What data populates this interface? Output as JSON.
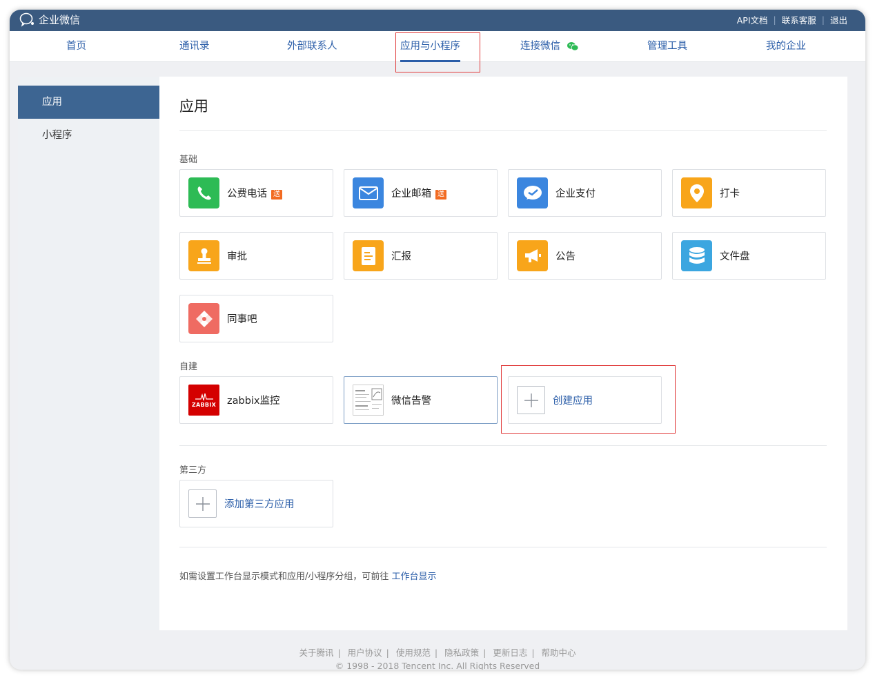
{
  "app": {
    "logo_text": "企业微信"
  },
  "top_links": [
    "API文档",
    "联系客服",
    "退出"
  ],
  "nav": {
    "tabs": [
      "首页",
      "通讯录",
      "外部联系人",
      "应用与小程序",
      "连接微信",
      "管理工具",
      "我的企业"
    ],
    "active_index": 3
  },
  "sidebar": {
    "items": [
      "应用",
      "小程序"
    ],
    "active_index": 0
  },
  "page_title": "应用",
  "sections": {
    "basic": "基础",
    "custom": "自建",
    "third_party": "第三方"
  },
  "basic_apps": [
    {
      "label": "公费电话",
      "badge": "送",
      "icon": "phone-icon",
      "color": "#2dbb55"
    },
    {
      "label": "企业邮箱",
      "badge": "送",
      "icon": "mail-icon",
      "color": "#3b86df"
    },
    {
      "label": "企业支付",
      "icon": "pay-icon",
      "color": "#3b86df"
    },
    {
      "label": "打卡",
      "icon": "location-pin-icon",
      "color": "#f8a51a"
    },
    {
      "label": "审批",
      "icon": "stamp-icon",
      "color": "#f8a51a"
    },
    {
      "label": "汇报",
      "icon": "report-icon",
      "color": "#f8a51a"
    },
    {
      "label": "公告",
      "icon": "megaphone-icon",
      "color": "#f8a51a"
    },
    {
      "label": "文件盘",
      "icon": "database-icon",
      "color": "#3ba6e0"
    },
    {
      "label": "同事吧",
      "icon": "colleague-bar-icon",
      "color": "#ef6b62"
    }
  ],
  "custom_apps": [
    {
      "label": "zabbix监控",
      "icon": "zabbix-logo",
      "logo_text": "ZABBIX",
      "color": "#d40000"
    },
    {
      "label": "微信告警",
      "icon": "wechat-alert-thumbnail"
    }
  ],
  "create_app_label": "创建应用",
  "add_third_party_label": "添加第三方应用",
  "hint": {
    "text": "如需设置工作台显示模式和应用/小程序分组，可前往",
    "link": "工作台显示"
  },
  "footer": {
    "links": [
      "关于腾讯",
      "用户协议",
      "使用规范",
      "隐私政策",
      "更新日志",
      "帮助中心"
    ],
    "copyright": "© 1998 - 2018 Tencent Inc. All Rights Reserved"
  },
  "colors": {
    "topbar": "#3a5a80",
    "accent": "#2a5da8",
    "highlight_box": "#e03a3a"
  }
}
